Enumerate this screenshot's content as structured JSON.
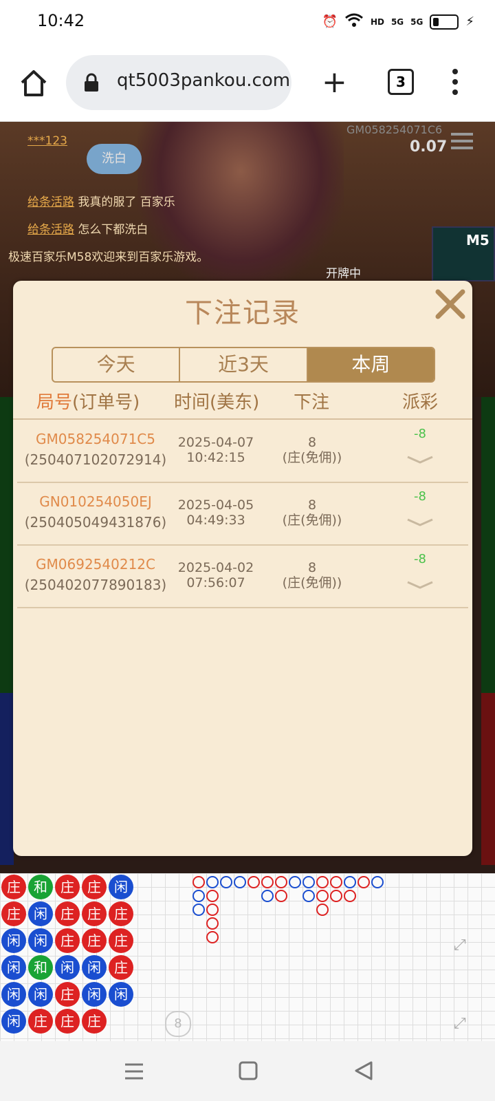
{
  "status_bar": {
    "time": "10:42",
    "network": "5G",
    "hd": "HD"
  },
  "browser": {
    "url": "qt5003pankou.com",
    "tab_count": "3"
  },
  "game": {
    "user": "***123",
    "wash_badge": "洗白",
    "game_id": "GM058254071C6",
    "balance": "0.07",
    "chat": [
      {
        "name": "给条活路",
        "text": "我真的服了 百家乐"
      },
      {
        "name": "给条活路",
        "text": "怎么下都洗白"
      }
    ],
    "welcome": "极速百家乐M58欢迎来到百家乐游戏。",
    "status": "开牌中",
    "side_label": "M5",
    "roadmap_chips": [
      "庄",
      "庄",
      "闲",
      "闲",
      "闲",
      "闲",
      "和",
      "闲",
      "闲",
      "和",
      "闲",
      "庄",
      "庄",
      "庄",
      "庄",
      "闲",
      "庄",
      "庄",
      "庄",
      "庄",
      "庄",
      "闲",
      "闲",
      "庄",
      "闲",
      "庄",
      "庄",
      "庄",
      "闲"
    ],
    "roadmap_number": "8"
  },
  "modal": {
    "title": "下注记录",
    "tabs": [
      {
        "label": "今天",
        "active": false
      },
      {
        "label": "近3天",
        "active": false
      },
      {
        "label": "本周",
        "active": true
      }
    ],
    "columns": {
      "id_part1": "局号",
      "id_part2": "(订单号)",
      "time": "时间(美东)",
      "bet": "下注",
      "payout": "派彩"
    },
    "rows": [
      {
        "game_id": "GM058254071C5",
        "order": "(250407102072914)",
        "date": "2025-04-07",
        "time": "10:42:15",
        "amount": "8",
        "bet_type": "(庄(免佣))",
        "payout": "-8"
      },
      {
        "game_id": "GN010254050EJ",
        "order": "(250405049431876)",
        "date": "2025-04-05",
        "time": "04:49:33",
        "amount": "8",
        "bet_type": "(庄(免佣))",
        "payout": "-8"
      },
      {
        "game_id": "GM0692540212C",
        "order": "(250402077890183)",
        "date": "2025-04-02",
        "time": "07:56:07",
        "amount": "8",
        "bet_type": "(庄(免佣))",
        "payout": "-8"
      }
    ]
  },
  "colors": {
    "accent": "#b0894f",
    "modal_bg": "#f8ebd5",
    "payout": "#4ac14a",
    "id_text": "#e08a4a"
  }
}
